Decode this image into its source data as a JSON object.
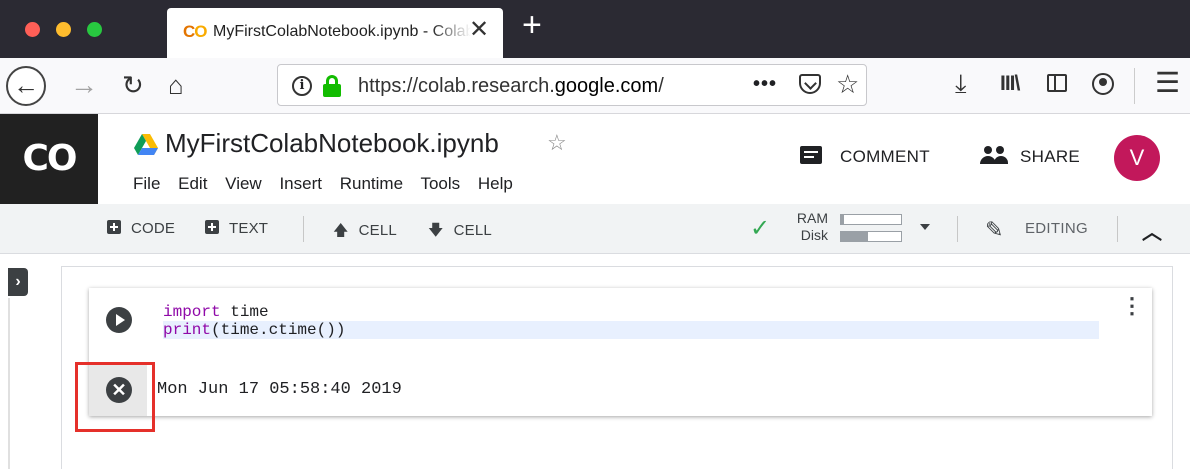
{
  "browser": {
    "tab_logo_c": "C",
    "tab_logo_o": "O",
    "tab_title": "MyFirstColabNotebook.ipynb - Colaboratory",
    "tab_close": "✕",
    "new_tab": "+",
    "url_prefix": "https://colab.research.",
    "url_domain": "google.com",
    "url_suffix": "/",
    "page_actions": "•••"
  },
  "colab": {
    "logo": "CO",
    "notebook_title": "MyFirstColabNotebook.ipynb",
    "menu": [
      "File",
      "Edit",
      "View",
      "Insert",
      "Runtime",
      "Tools",
      "Help"
    ],
    "comment_label": "COMMENT",
    "share_label": "SHARE",
    "avatar_letter": "V",
    "avatar_color": "#c2185b"
  },
  "toolbar": {
    "code_label": "CODE",
    "text_label": "TEXT",
    "cell_up_label": "CELL",
    "cell_down_label": "CELL",
    "ram_label": "RAM",
    "disk_label": "Disk",
    "ram_usage": 0.05,
    "disk_usage": 0.45,
    "editing_label": "EDITING",
    "status_color": "#34a853"
  },
  "cell": {
    "code_lines": [
      {
        "keyword": "import",
        "rest": " time"
      },
      {
        "builtin": "print",
        "rest": "(time.ctime())"
      }
    ],
    "output": "Mon Jun 17 05:58:40 2019"
  }
}
